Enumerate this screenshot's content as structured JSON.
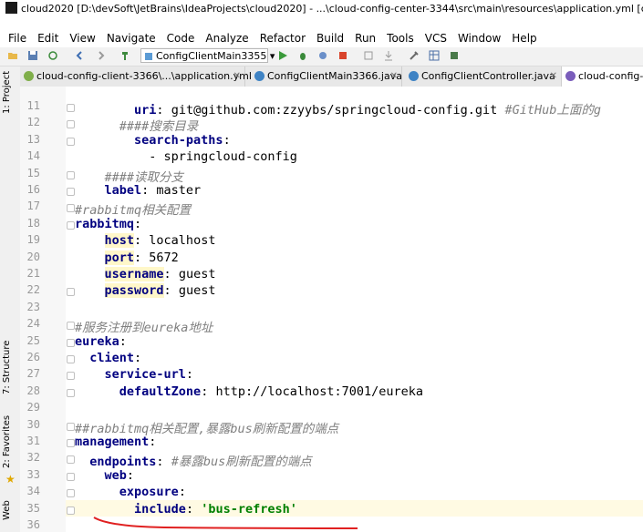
{
  "window": {
    "title": "cloud2020 [D:\\devSoft\\JetBrains\\IdeaProjects\\cloud2020] - ...\\cloud-config-center-3344\\src\\main\\resources\\application.yml [cloud-config-ce"
  },
  "menu": [
    "File",
    "Edit",
    "View",
    "Navigate",
    "Code",
    "Analyze",
    "Refactor",
    "Build",
    "Run",
    "Tools",
    "VCS",
    "Window",
    "Help"
  ],
  "toolbar": {
    "run_config": "ConfigClientMain3355"
  },
  "tabs": [
    {
      "label": "cloud-config-client-3366\\...\\application.yml",
      "icon_color": "#7fae4a"
    },
    {
      "label": "ConfigClientMain3366.java",
      "icon_color": "#3f83c4"
    },
    {
      "label": "ConfigClientController.java",
      "icon_color": "#3f83c4"
    },
    {
      "label": "cloud-config-ce",
      "icon_color": "#7a5dbb"
    }
  ],
  "side_tools": {
    "project": "1: Project",
    "structure": "7: Structure",
    "favorites": "2: Favorites",
    "web": "Web"
  },
  "lines": [
    {
      "n": "11",
      "indent": "        ",
      "key": "uri",
      "sep": ": ",
      "val": "git@github.com:zzyybs/springcloud-config.git",
      "cmt": " #GitHub上面的g"
    },
    {
      "n": "12",
      "indent": "      ",
      "cmt": "####搜索目录"
    },
    {
      "n": "13",
      "indent": "        ",
      "key": "search-paths",
      "sep": ":"
    },
    {
      "n": "14",
      "indent": "          ",
      "val": "- springcloud-config"
    },
    {
      "n": "15",
      "indent": "    ",
      "cmt": "####读取分支"
    },
    {
      "n": "16",
      "indent": "    ",
      "key": "label",
      "sep": ": ",
      "val": "master"
    },
    {
      "n": "17",
      "indent": "",
      "cmt": "#rabbitmq相关配置"
    },
    {
      "n": "18",
      "indent": "",
      "key": "rabbitmq",
      "sep": ":"
    },
    {
      "n": "19",
      "indent": "    ",
      "key": "host",
      "sep": ": ",
      "val": "localhost",
      "hl": true
    },
    {
      "n": "20",
      "indent": "    ",
      "key": "port",
      "sep": ": ",
      "val": "5672",
      "hl": true
    },
    {
      "n": "21",
      "indent": "    ",
      "key": "username",
      "sep": ": ",
      "val": "guest",
      "hl": true
    },
    {
      "n": "22",
      "indent": "    ",
      "key": "password",
      "sep": ": ",
      "val": "guest",
      "hl": true
    },
    {
      "n": "23",
      "indent": ""
    },
    {
      "n": "24",
      "indent": "",
      "cmt": "#服务注册到eureka地址"
    },
    {
      "n": "25",
      "indent": "",
      "key": "eureka",
      "sep": ":"
    },
    {
      "n": "26",
      "indent": "  ",
      "key": "client",
      "sep": ":"
    },
    {
      "n": "27",
      "indent": "    ",
      "key": "service-url",
      "sep": ":"
    },
    {
      "n": "28",
      "indent": "      ",
      "key": "defaultZone",
      "sep": ": ",
      "val": "http://localhost:7001/eureka"
    },
    {
      "n": "29",
      "indent": ""
    },
    {
      "n": "30",
      "indent": "",
      "cmt": "##rabbitmq相关配置,暴露bus刷新配置的端点"
    },
    {
      "n": "31",
      "indent": "",
      "key": "management",
      "sep": ":"
    },
    {
      "n": "32",
      "indent": "  ",
      "key": "endpoints",
      "sep": ": ",
      "cmt": "#暴露bus刷新配置的端点"
    },
    {
      "n": "33",
      "indent": "    ",
      "key": "web",
      "sep": ":"
    },
    {
      "n": "34",
      "indent": "      ",
      "key": "exposure",
      "sep": ":"
    },
    {
      "n": "35",
      "indent": "        ",
      "key": "include",
      "sep": ": ",
      "str": "'bus-refresh'"
    },
    {
      "n": "36",
      "indent": ""
    }
  ],
  "colors": {
    "key": "#000080",
    "comment": "#808080",
    "string": "#008000",
    "annotation_red": "#e02020"
  }
}
